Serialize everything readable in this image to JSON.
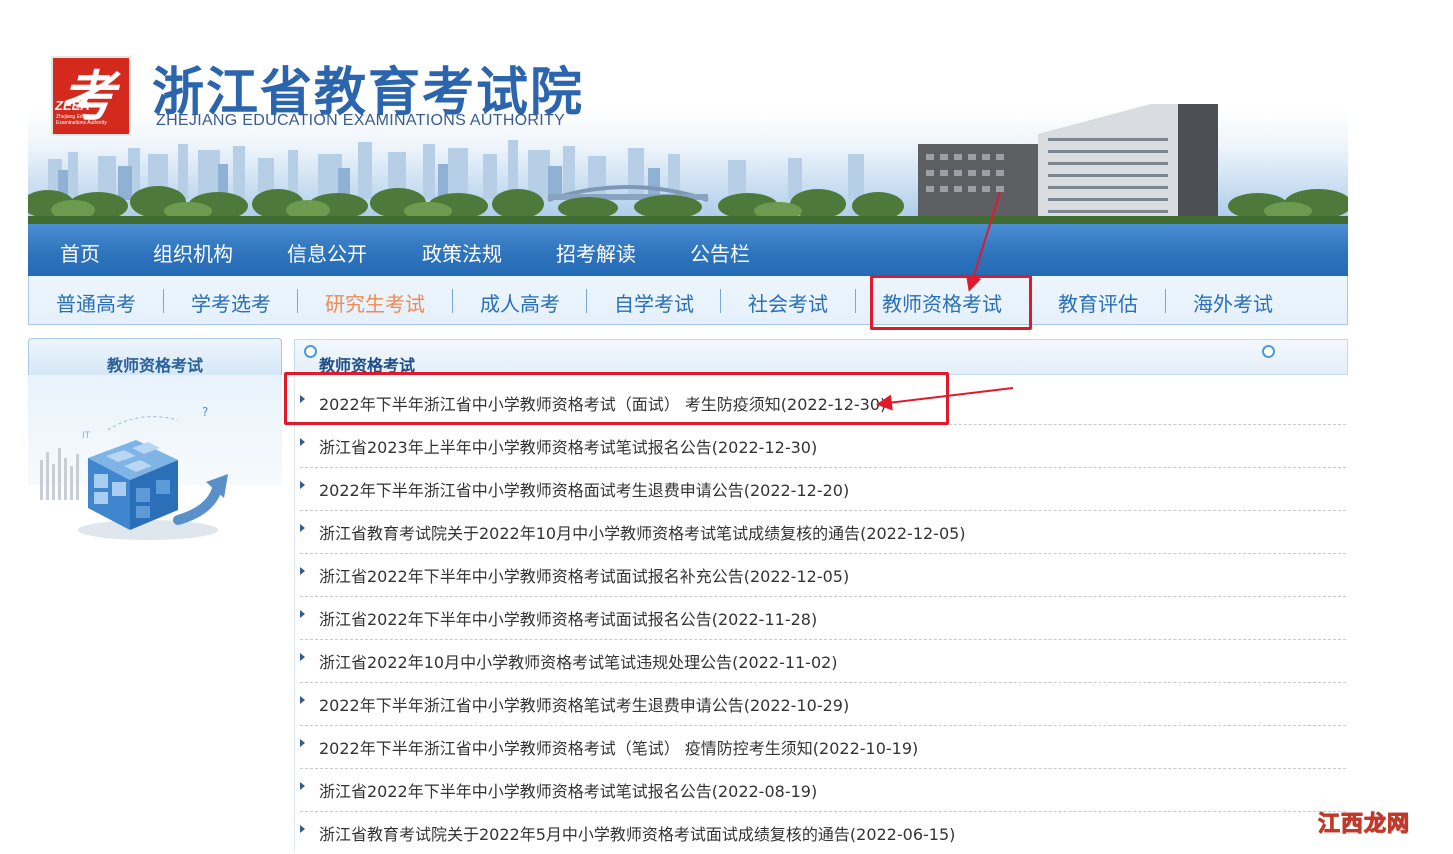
{
  "header": {
    "title": "浙江省教育考试院",
    "subtitle": "ZHEJIANG EDUCATION EXAMINATIONS AUTHORITY",
    "logo": {
      "glyph": "考",
      "abbr": "ZEEA",
      "small_text": "Zhejiang Education Examinations Authority"
    }
  },
  "main_nav": {
    "items": [
      {
        "label": "首页"
      },
      {
        "label": "组织机构"
      },
      {
        "label": "信息公开"
      },
      {
        "label": "政策法规"
      },
      {
        "label": "招考解读"
      },
      {
        "label": "公告栏"
      }
    ]
  },
  "sub_nav": {
    "items": [
      {
        "label": "普通高考"
      },
      {
        "label": "学考选考"
      },
      {
        "label": "研究生考试"
      },
      {
        "label": "成人高考"
      },
      {
        "label": "自学考试"
      },
      {
        "label": "社会考试"
      },
      {
        "label": "教师资格考试"
      },
      {
        "label": "教育评估"
      },
      {
        "label": "海外考试"
      }
    ],
    "active_index": 2,
    "highlighted_index": 6
  },
  "sidebar": {
    "title": "教师资格考试"
  },
  "content": {
    "title": "教师资格考试",
    "news": [
      {
        "title": "2022年下半年浙江省中小学教师资格考试（面试） 考生防疫须知(2022-12-30)"
      },
      {
        "title": "浙江省2023年上半年中小学教师资格考试笔试报名公告(2022-12-30)"
      },
      {
        "title": "2022年下半年浙江省中小学教师资格面试考生退费申请公告(2022-12-20)"
      },
      {
        "title": "浙江省教育考试院关于2022年10月中小学教师资格考试笔试成绩复核的通告(2022-12-05)"
      },
      {
        "title": "浙江省2022年下半年中小学教师资格考试面试报名补充公告(2022-12-05)"
      },
      {
        "title": "浙江省2022年下半年中小学教师资格考试面试报名公告(2022-11-28)"
      },
      {
        "title": "浙江省2022年10月中小学教师资格考试笔试违规处理公告(2022-11-02)"
      },
      {
        "title": "2022年下半年浙江省中小学教师资格笔试考生退费申请公告(2022-10-29)"
      },
      {
        "title": "2022年下半年浙江省中小学教师资格考试（笔试） 疫情防控考生须知(2022-10-19)"
      },
      {
        "title": "浙江省2022年下半年中小学教师资格考试笔试报名公告(2022-08-19)"
      },
      {
        "title": "浙江省教育考试院关于2022年5月中小学教师资格考试面试成绩复核的通告(2022-06-15)"
      }
    ]
  },
  "watermark": "江西龙网",
  "colors": {
    "nav_blue": "#2f74bd",
    "title_blue": "#2a65ad",
    "active_orange": "#f08a52",
    "annotation_red": "#e0192b",
    "logo_red": "#d42a1e"
  }
}
